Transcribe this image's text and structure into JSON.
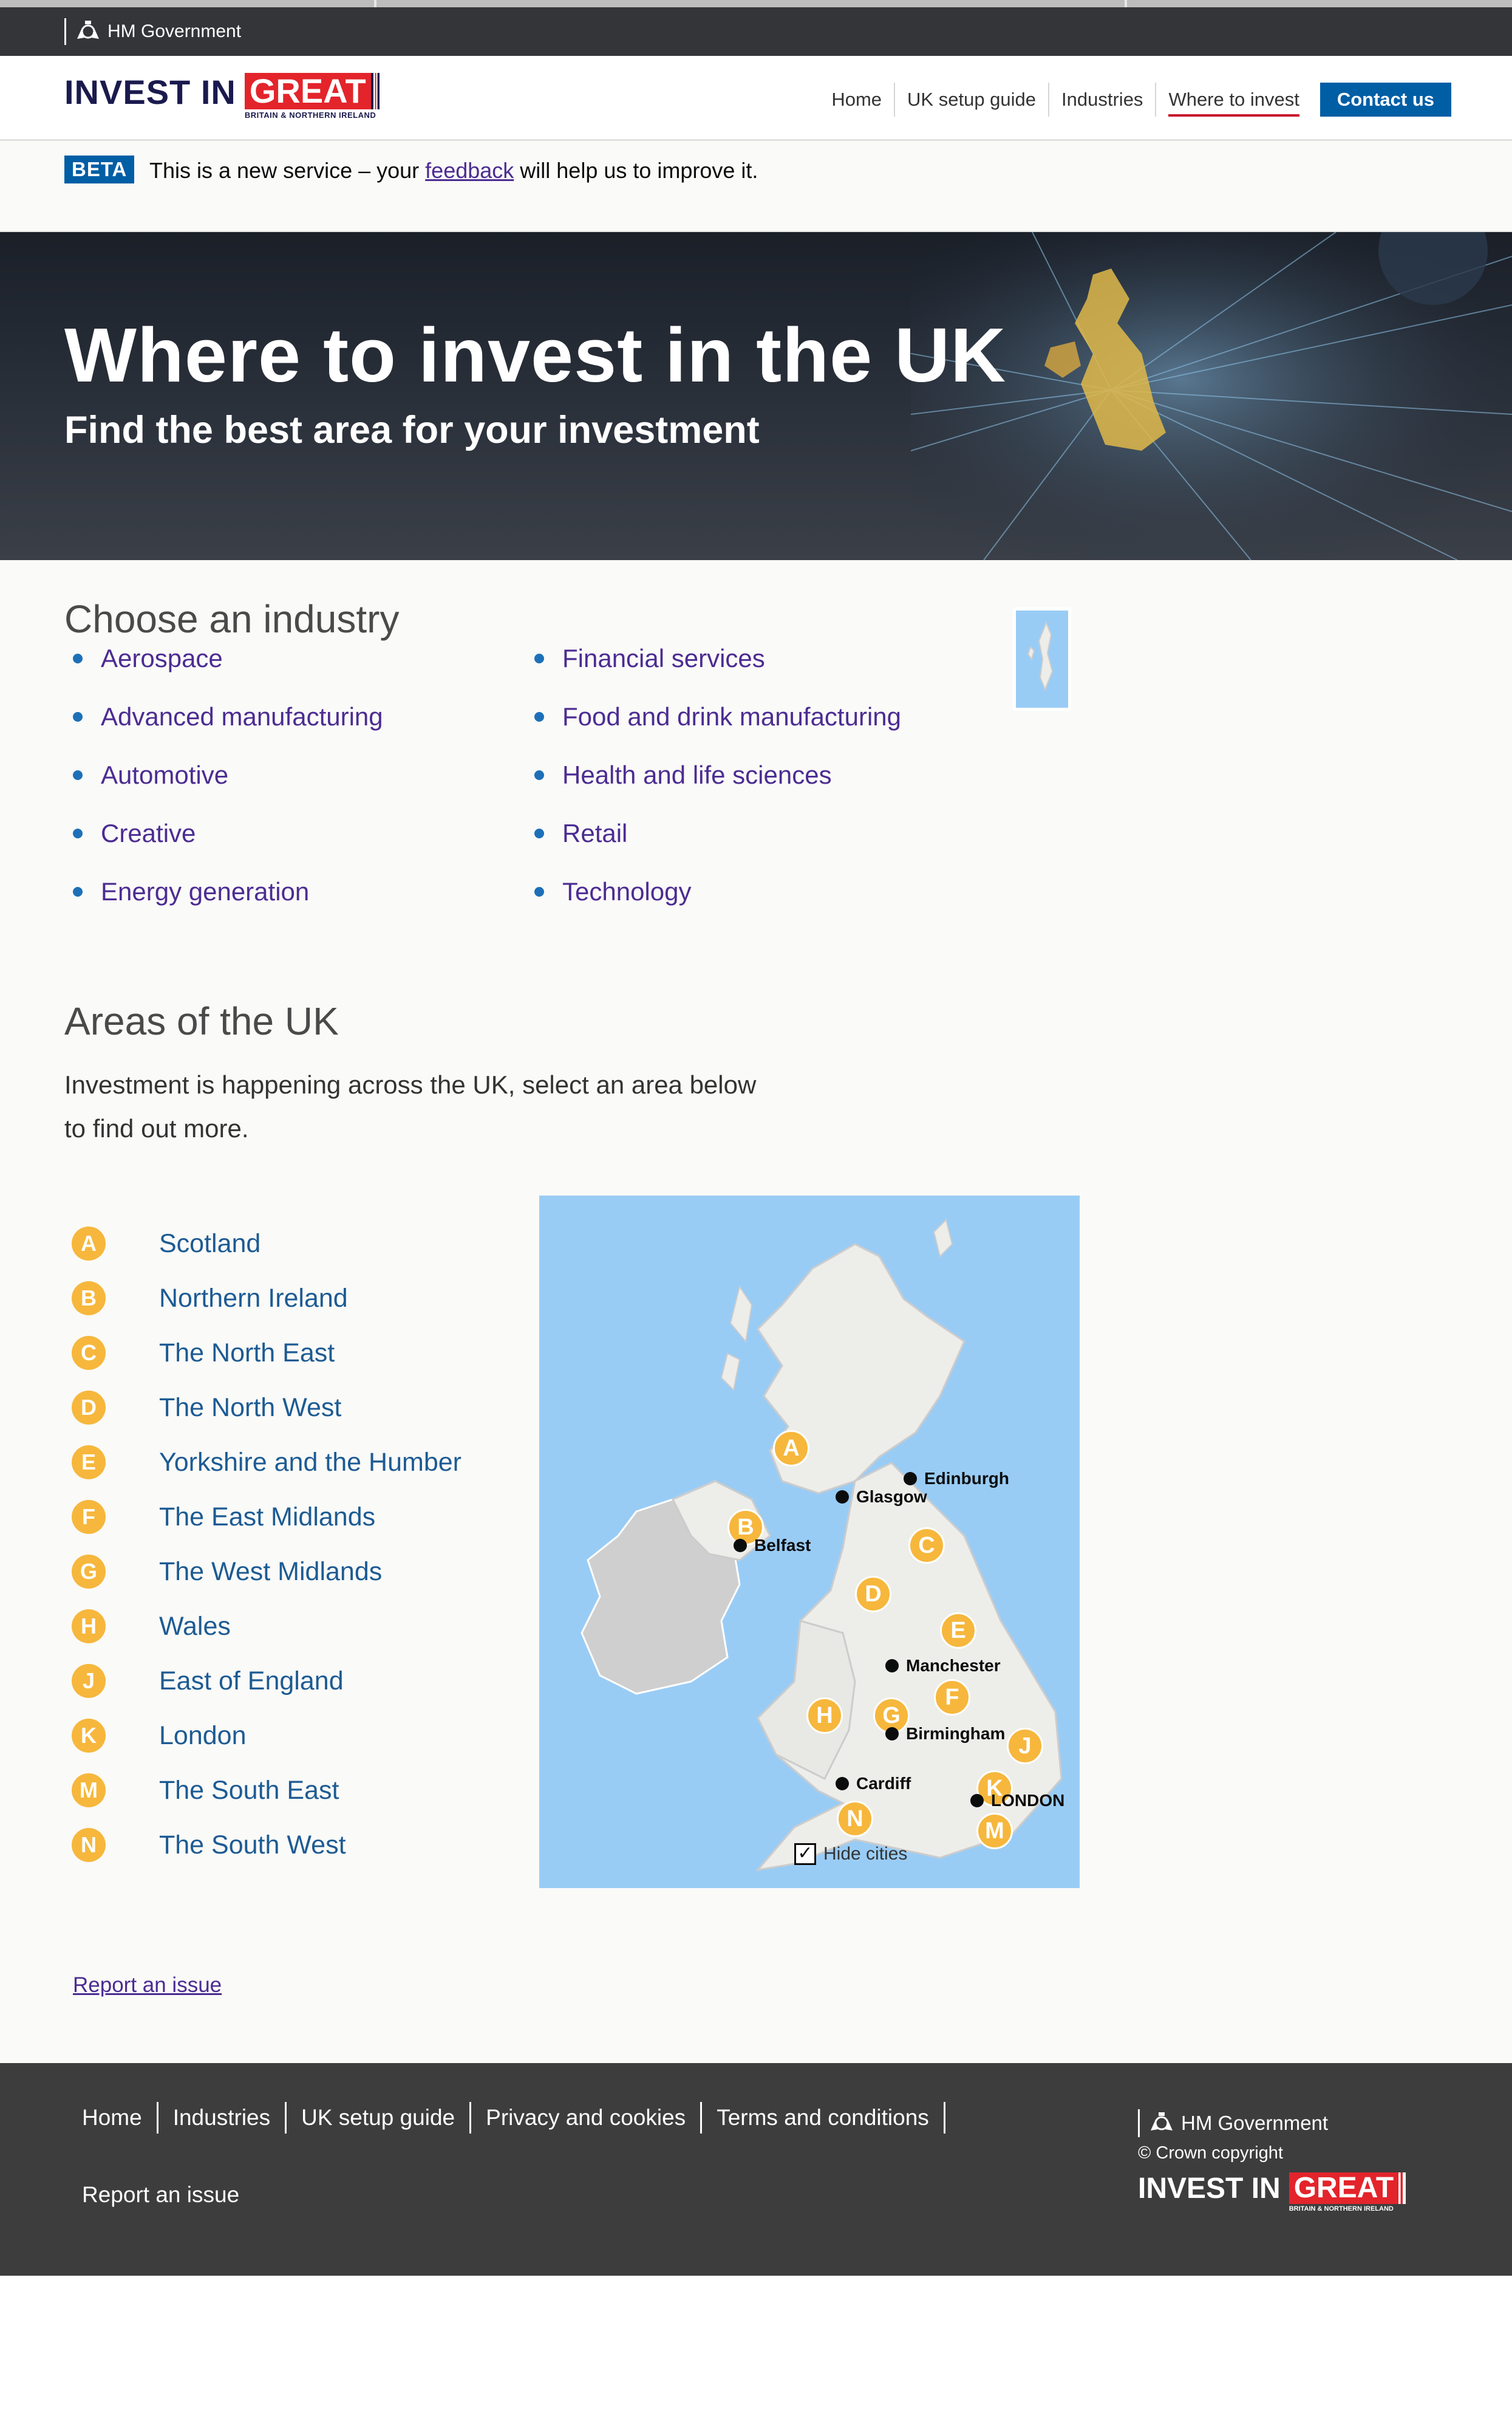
{
  "gov_bar": {
    "label": "HM Government"
  },
  "header": {
    "logo": {
      "invest": "INVEST IN",
      "great": "GREAT",
      "sub": "BRITAIN & NORTHERN IRELAND"
    },
    "nav": [
      {
        "label": "Home"
      },
      {
        "label": "UK setup guide"
      },
      {
        "label": "Industries"
      },
      {
        "label": "Where to invest",
        "active": true
      }
    ],
    "contact_label": "Contact us"
  },
  "beta": {
    "tag": "BETA",
    "text_before": "This is a new service – your ",
    "link": "feedback",
    "text_after": " will help us to improve it."
  },
  "hero": {
    "title": "Where to invest in the UK",
    "subtitle": "Find the best area for your investment"
  },
  "industries": {
    "heading": "Choose an industry",
    "col1": [
      "Aerospace",
      "Advanced manufacturing",
      "Automotive",
      "Creative",
      "Energy generation"
    ],
    "col2": [
      "Financial services",
      "Food and drink manufacturing",
      "Health and life sciences",
      "Retail",
      "Technology"
    ]
  },
  "areas": {
    "heading": "Areas of the UK",
    "intro": "Investment is happening across the UK, select an area below to find out more.",
    "regions": [
      {
        "letter": "A",
        "label": "Scotland"
      },
      {
        "letter": "B",
        "label": "Northern Ireland"
      },
      {
        "letter": "C",
        "label": "The North East"
      },
      {
        "letter": "D",
        "label": "The North West"
      },
      {
        "letter": "E",
        "label": "Yorkshire and the Humber"
      },
      {
        "letter": "F",
        "label": "The East Midlands"
      },
      {
        "letter": "G",
        "label": "The West Midlands"
      },
      {
        "letter": "H",
        "label": "Wales"
      },
      {
        "letter": "J",
        "label": "East of England"
      },
      {
        "letter": "K",
        "label": "London"
      },
      {
        "letter": "M",
        "label": "The South East"
      },
      {
        "letter": "N",
        "label": "The South West"
      }
    ],
    "map": {
      "cities": [
        "Edinburgh",
        "Glasgow",
        "Belfast",
        "Manchester",
        "Birmingham",
        "Cardiff",
        "LONDON"
      ],
      "hide_cities_label": "Hide cities",
      "hide_cities_checked": true
    }
  },
  "report_issue": "Report an issue",
  "footer": {
    "links": [
      "Home",
      "Industries",
      "UK setup guide",
      "Privacy and cookies",
      "Terms and conditions"
    ],
    "report": "Report an issue",
    "gov": "HM Government",
    "copyright": "© Crown copyright",
    "logo": {
      "invest": "INVEST IN",
      "great": "GREAT",
      "sub": "BRITAIN & NORTHERN IRELAND"
    }
  },
  "colors": {
    "navy": "#1a1a4e",
    "great_red": "#e3242b",
    "link_purple": "#4c2c92",
    "link_blue": "#1d5b93",
    "badge_yellow": "#f6b73c",
    "sea_blue": "#99ccf5",
    "button_blue": "#005ea5",
    "footer_grey": "#3d3d3d"
  }
}
